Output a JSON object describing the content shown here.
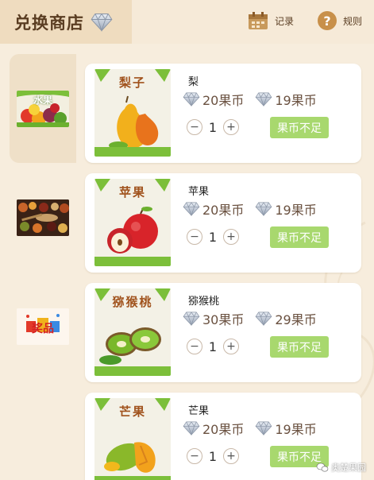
{
  "header": {
    "title": "兑换商店",
    "records_label": "记录",
    "rules_label": "规则"
  },
  "sidebar": {
    "items": [
      {
        "label": "水果",
        "active": true
      },
      {
        "label": "",
        "active": false
      },
      {
        "label": "",
        "active": false
      }
    ]
  },
  "products": [
    {
      "image_label": "梨子",
      "name": "梨",
      "price": "20果币",
      "original_price": "19果币",
      "quantity": "1",
      "button_label": "果币不足",
      "minus": "−",
      "plus": "+"
    },
    {
      "image_label": "苹果",
      "name": "苹果",
      "price": "20果币",
      "original_price": "19果币",
      "quantity": "1",
      "button_label": "果币不足",
      "minus": "−",
      "plus": "+"
    },
    {
      "image_label": "猕猴桃",
      "name": "猕猴桃",
      "price": "30果币",
      "original_price": "29果币",
      "quantity": "1",
      "button_label": "果币不足",
      "minus": "−",
      "plus": "+"
    },
    {
      "image_label": "芒果",
      "name": "芒果",
      "price": "20果币",
      "original_price": "19果币",
      "quantity": "1",
      "button_label": "果币不足",
      "minus": "−",
      "plus": "+"
    }
  ],
  "watermark": {
    "text": "奥楚果园"
  },
  "colors": {
    "accent_green": "#a8d86e",
    "brand_brown": "#5a3d22",
    "background": "#f7eddd"
  }
}
